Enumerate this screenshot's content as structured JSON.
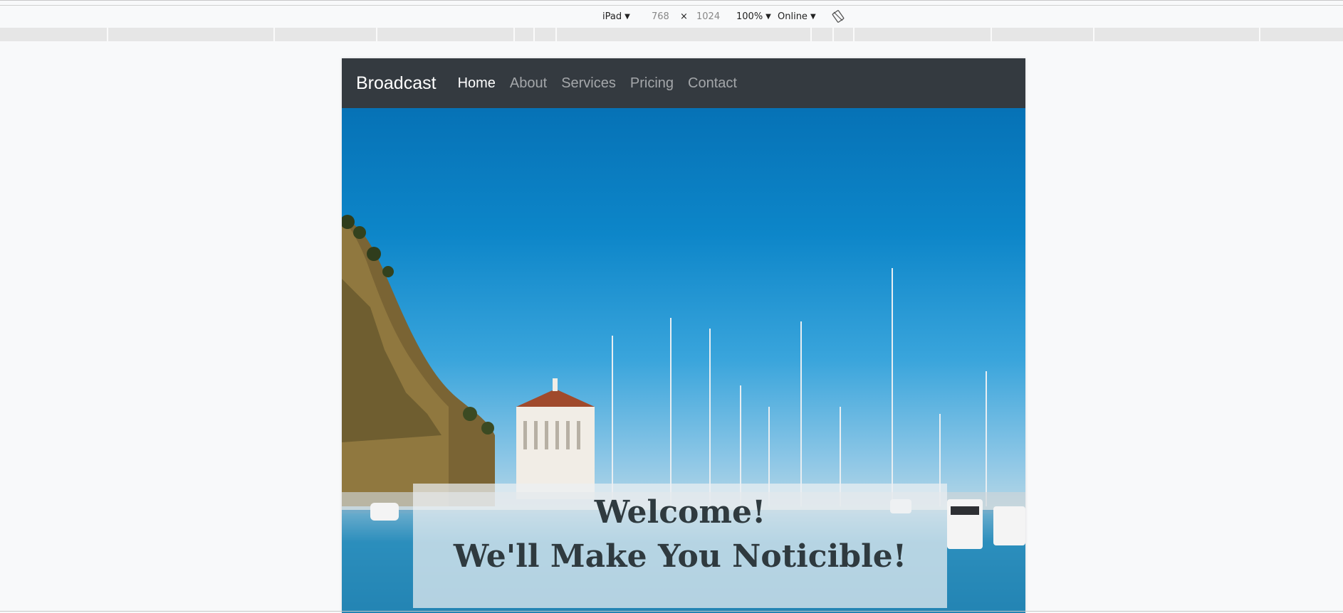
{
  "devtools": {
    "device": "iPad",
    "width": "768",
    "times": "×",
    "height": "1024",
    "zoom": "100%",
    "network": "Online",
    "icons": {
      "rotate": "rotate-icon",
      "caret": "▼"
    }
  },
  "site": {
    "brand": "Broadcast",
    "nav": [
      {
        "label": "Home",
        "active": true
      },
      {
        "label": "About",
        "active": false
      },
      {
        "label": "Services",
        "active": false
      },
      {
        "label": "Pricing",
        "active": false
      },
      {
        "label": "Contact",
        "active": false
      }
    ],
    "hero": {
      "line1": "Welcome!",
      "line2": "We'll Make You Noticible!"
    }
  },
  "colors": {
    "navbar": "#343a40",
    "page_bg": "#f8f9fa",
    "sky": "#0d86c9"
  }
}
